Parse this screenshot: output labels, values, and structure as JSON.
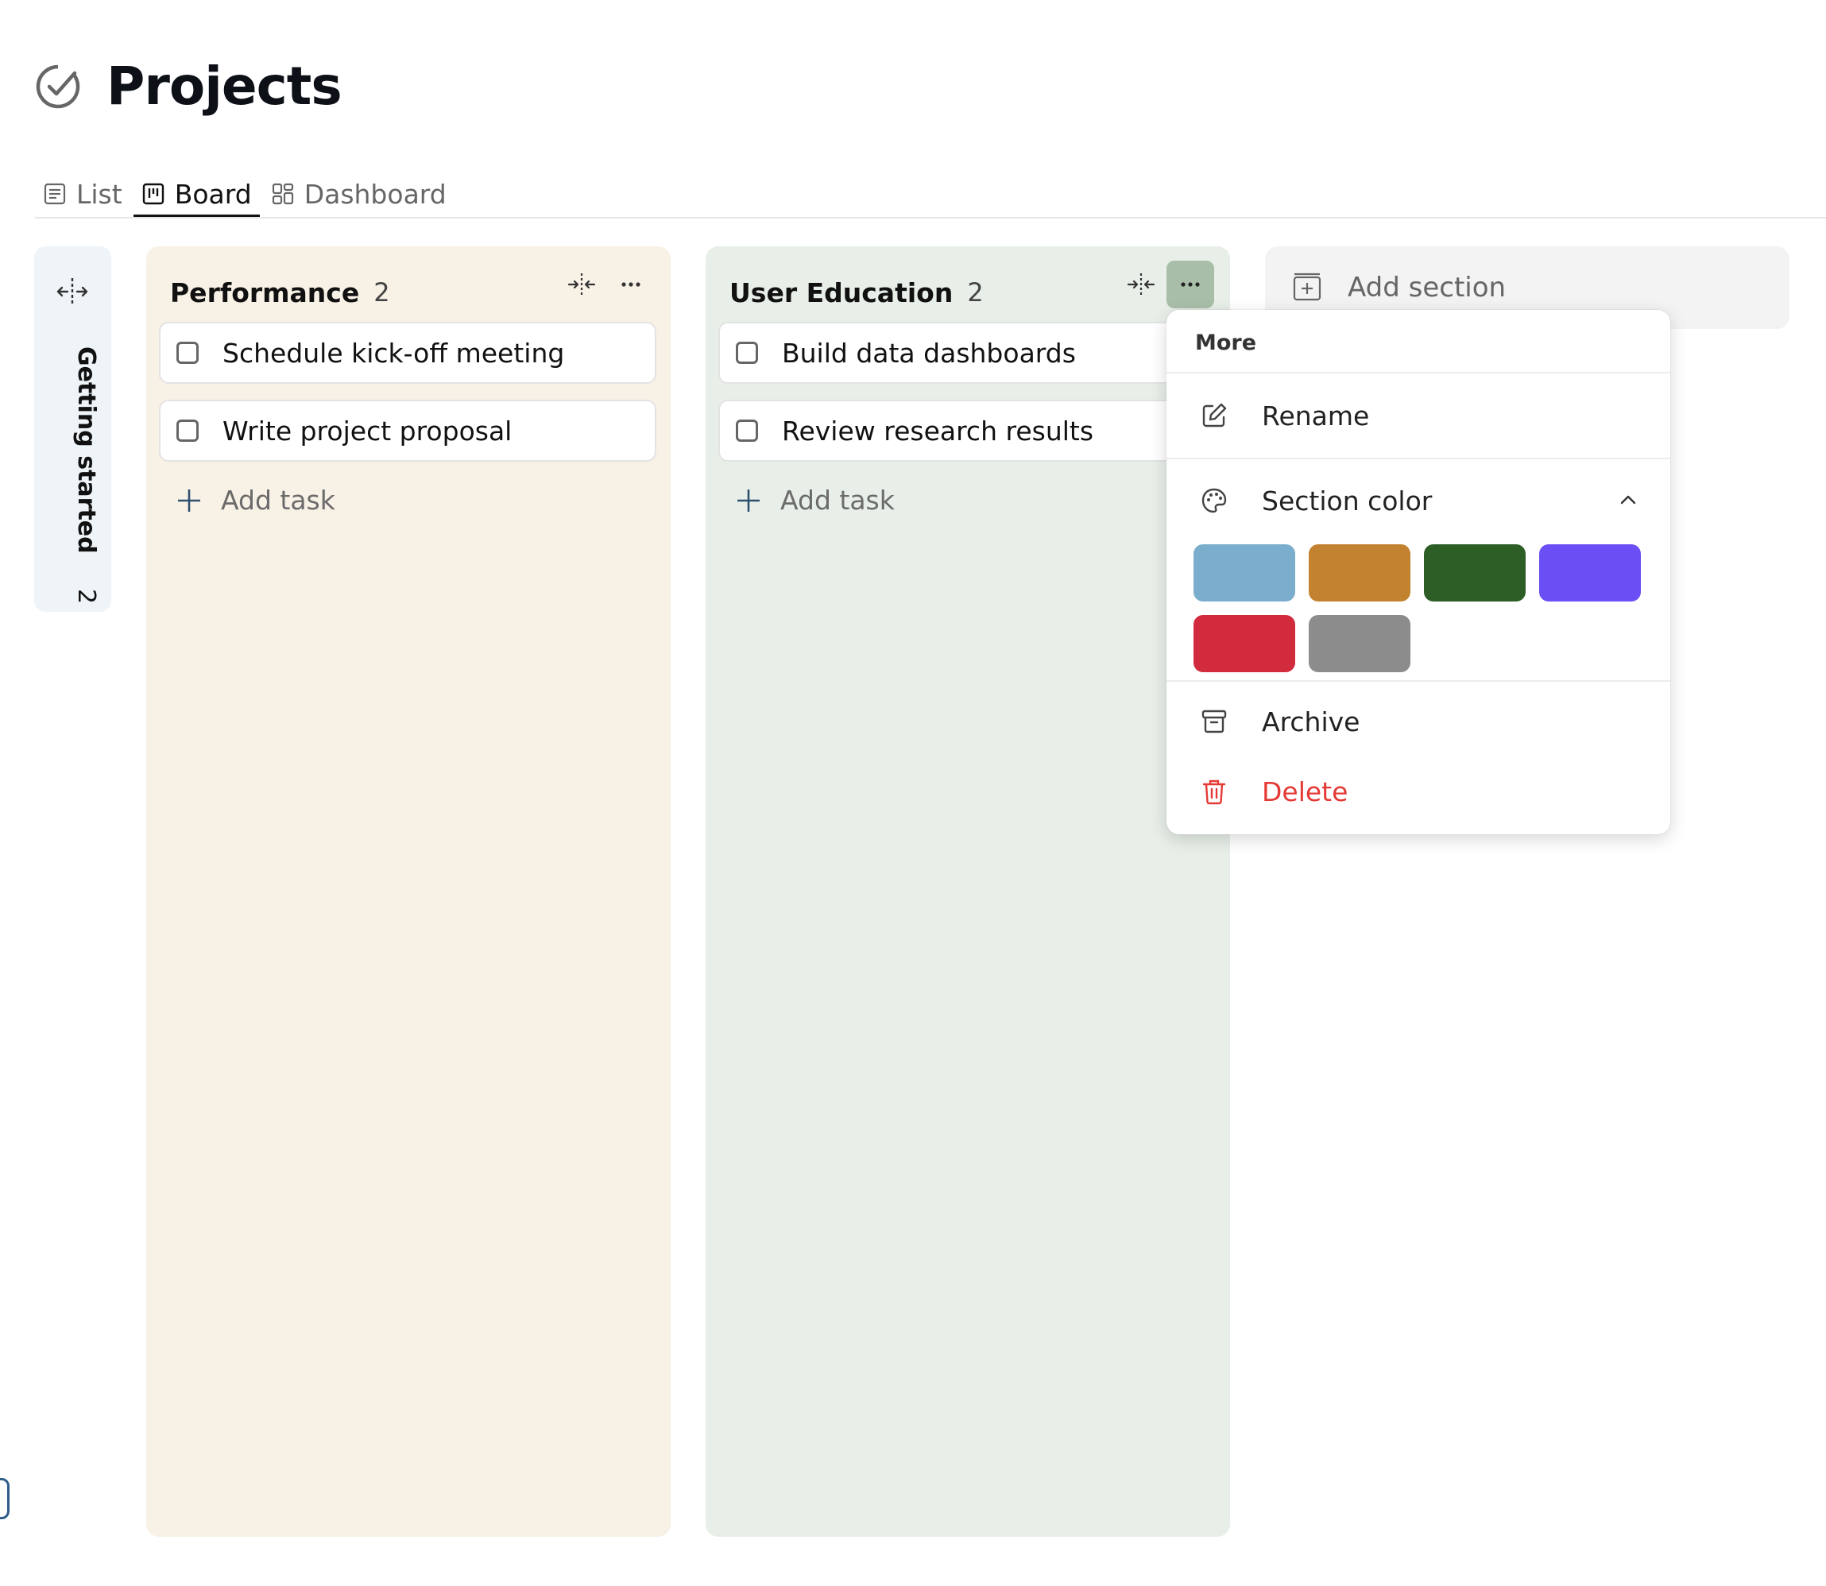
{
  "page": {
    "title": "Projects"
  },
  "tabs": [
    {
      "label": "List",
      "icon": "list-icon",
      "active": false
    },
    {
      "label": "Board",
      "icon": "board-icon",
      "active": true
    },
    {
      "label": "Dashboard",
      "icon": "dashboard-icon",
      "active": false
    }
  ],
  "collapsed_section": {
    "name": "Getting started",
    "count": "2"
  },
  "columns": [
    {
      "name": "Performance",
      "count": "2",
      "bg": "#f8f1e6",
      "tasks": [
        "Schedule kick-off meeting",
        "Write project proposal"
      ],
      "add_task_label": "Add task"
    },
    {
      "name": "User Education",
      "count": "2",
      "bg": "#e8eee8",
      "tasks": [
        "Build data dashboards",
        "Review research results"
      ],
      "add_task_label": "Add task"
    }
  ],
  "add_section_label": "Add section",
  "menu": {
    "title": "More",
    "rename": "Rename",
    "section_color": "Section color",
    "colors": [
      "#7aaecc",
      "#c3822f",
      "#2c5e26",
      "#6b4ff5",
      "#d12b3d",
      "#8c8c8c"
    ],
    "archive": "Archive",
    "delete": "Delete"
  }
}
